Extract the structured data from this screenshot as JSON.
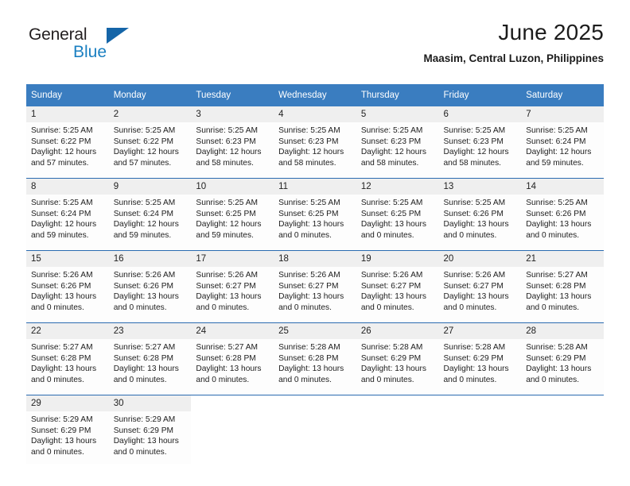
{
  "brand": {
    "name_part1": "General",
    "name_part2": "Blue",
    "logo_icon": "triangle-logo-icon",
    "colors": {
      "general": "#231f20",
      "blue": "#1a7fc1",
      "triangle": "#1565a8"
    }
  },
  "header": {
    "title": "June 2025",
    "subtitle": "Maasim, Central Luzon, Philippines"
  },
  "theme": {
    "header_row_bg": "#3a7dc0",
    "header_row_text": "#ffffff",
    "daynum_bg": "#efefef",
    "row_divider": "#2a6bb0"
  },
  "calendar": {
    "weekday_headers": [
      "Sunday",
      "Monday",
      "Tuesday",
      "Wednesday",
      "Thursday",
      "Friday",
      "Saturday"
    ],
    "weeks": [
      [
        {
          "day": "1",
          "sunrise": "Sunrise: 5:25 AM",
          "sunset": "Sunset: 6:22 PM",
          "daylight": "Daylight: 12 hours and 57 minutes."
        },
        {
          "day": "2",
          "sunrise": "Sunrise: 5:25 AM",
          "sunset": "Sunset: 6:22 PM",
          "daylight": "Daylight: 12 hours and 57 minutes."
        },
        {
          "day": "3",
          "sunrise": "Sunrise: 5:25 AM",
          "sunset": "Sunset: 6:23 PM",
          "daylight": "Daylight: 12 hours and 58 minutes."
        },
        {
          "day": "4",
          "sunrise": "Sunrise: 5:25 AM",
          "sunset": "Sunset: 6:23 PM",
          "daylight": "Daylight: 12 hours and 58 minutes."
        },
        {
          "day": "5",
          "sunrise": "Sunrise: 5:25 AM",
          "sunset": "Sunset: 6:23 PM",
          "daylight": "Daylight: 12 hours and 58 minutes."
        },
        {
          "day": "6",
          "sunrise": "Sunrise: 5:25 AM",
          "sunset": "Sunset: 6:23 PM",
          "daylight": "Daylight: 12 hours and 58 minutes."
        },
        {
          "day": "7",
          "sunrise": "Sunrise: 5:25 AM",
          "sunset": "Sunset: 6:24 PM",
          "daylight": "Daylight: 12 hours and 59 minutes."
        }
      ],
      [
        {
          "day": "8",
          "sunrise": "Sunrise: 5:25 AM",
          "sunset": "Sunset: 6:24 PM",
          "daylight": "Daylight: 12 hours and 59 minutes."
        },
        {
          "day": "9",
          "sunrise": "Sunrise: 5:25 AM",
          "sunset": "Sunset: 6:24 PM",
          "daylight": "Daylight: 12 hours and 59 minutes."
        },
        {
          "day": "10",
          "sunrise": "Sunrise: 5:25 AM",
          "sunset": "Sunset: 6:25 PM",
          "daylight": "Daylight: 12 hours and 59 minutes."
        },
        {
          "day": "11",
          "sunrise": "Sunrise: 5:25 AM",
          "sunset": "Sunset: 6:25 PM",
          "daylight": "Daylight: 13 hours and 0 minutes."
        },
        {
          "day": "12",
          "sunrise": "Sunrise: 5:25 AM",
          "sunset": "Sunset: 6:25 PM",
          "daylight": "Daylight: 13 hours and 0 minutes."
        },
        {
          "day": "13",
          "sunrise": "Sunrise: 5:25 AM",
          "sunset": "Sunset: 6:26 PM",
          "daylight": "Daylight: 13 hours and 0 minutes."
        },
        {
          "day": "14",
          "sunrise": "Sunrise: 5:25 AM",
          "sunset": "Sunset: 6:26 PM",
          "daylight": "Daylight: 13 hours and 0 minutes."
        }
      ],
      [
        {
          "day": "15",
          "sunrise": "Sunrise: 5:26 AM",
          "sunset": "Sunset: 6:26 PM",
          "daylight": "Daylight: 13 hours and 0 minutes."
        },
        {
          "day": "16",
          "sunrise": "Sunrise: 5:26 AM",
          "sunset": "Sunset: 6:26 PM",
          "daylight": "Daylight: 13 hours and 0 minutes."
        },
        {
          "day": "17",
          "sunrise": "Sunrise: 5:26 AM",
          "sunset": "Sunset: 6:27 PM",
          "daylight": "Daylight: 13 hours and 0 minutes."
        },
        {
          "day": "18",
          "sunrise": "Sunrise: 5:26 AM",
          "sunset": "Sunset: 6:27 PM",
          "daylight": "Daylight: 13 hours and 0 minutes."
        },
        {
          "day": "19",
          "sunrise": "Sunrise: 5:26 AM",
          "sunset": "Sunset: 6:27 PM",
          "daylight": "Daylight: 13 hours and 0 minutes."
        },
        {
          "day": "20",
          "sunrise": "Sunrise: 5:26 AM",
          "sunset": "Sunset: 6:27 PM",
          "daylight": "Daylight: 13 hours and 0 minutes."
        },
        {
          "day": "21",
          "sunrise": "Sunrise: 5:27 AM",
          "sunset": "Sunset: 6:28 PM",
          "daylight": "Daylight: 13 hours and 0 minutes."
        }
      ],
      [
        {
          "day": "22",
          "sunrise": "Sunrise: 5:27 AM",
          "sunset": "Sunset: 6:28 PM",
          "daylight": "Daylight: 13 hours and 0 minutes."
        },
        {
          "day": "23",
          "sunrise": "Sunrise: 5:27 AM",
          "sunset": "Sunset: 6:28 PM",
          "daylight": "Daylight: 13 hours and 0 minutes."
        },
        {
          "day": "24",
          "sunrise": "Sunrise: 5:27 AM",
          "sunset": "Sunset: 6:28 PM",
          "daylight": "Daylight: 13 hours and 0 minutes."
        },
        {
          "day": "25",
          "sunrise": "Sunrise: 5:28 AM",
          "sunset": "Sunset: 6:28 PM",
          "daylight": "Daylight: 13 hours and 0 minutes."
        },
        {
          "day": "26",
          "sunrise": "Sunrise: 5:28 AM",
          "sunset": "Sunset: 6:29 PM",
          "daylight": "Daylight: 13 hours and 0 minutes."
        },
        {
          "day": "27",
          "sunrise": "Sunrise: 5:28 AM",
          "sunset": "Sunset: 6:29 PM",
          "daylight": "Daylight: 13 hours and 0 minutes."
        },
        {
          "day": "28",
          "sunrise": "Sunrise: 5:28 AM",
          "sunset": "Sunset: 6:29 PM",
          "daylight": "Daylight: 13 hours and 0 minutes."
        }
      ],
      [
        {
          "day": "29",
          "sunrise": "Sunrise: 5:29 AM",
          "sunset": "Sunset: 6:29 PM",
          "daylight": "Daylight: 13 hours and 0 minutes."
        },
        {
          "day": "30",
          "sunrise": "Sunrise: 5:29 AM",
          "sunset": "Sunset: 6:29 PM",
          "daylight": "Daylight: 13 hours and 0 minutes."
        },
        {
          "day": "",
          "sunrise": "",
          "sunset": "",
          "daylight": ""
        },
        {
          "day": "",
          "sunrise": "",
          "sunset": "",
          "daylight": ""
        },
        {
          "day": "",
          "sunrise": "",
          "sunset": "",
          "daylight": ""
        },
        {
          "day": "",
          "sunrise": "",
          "sunset": "",
          "daylight": ""
        },
        {
          "day": "",
          "sunrise": "",
          "sunset": "",
          "daylight": ""
        }
      ]
    ]
  }
}
